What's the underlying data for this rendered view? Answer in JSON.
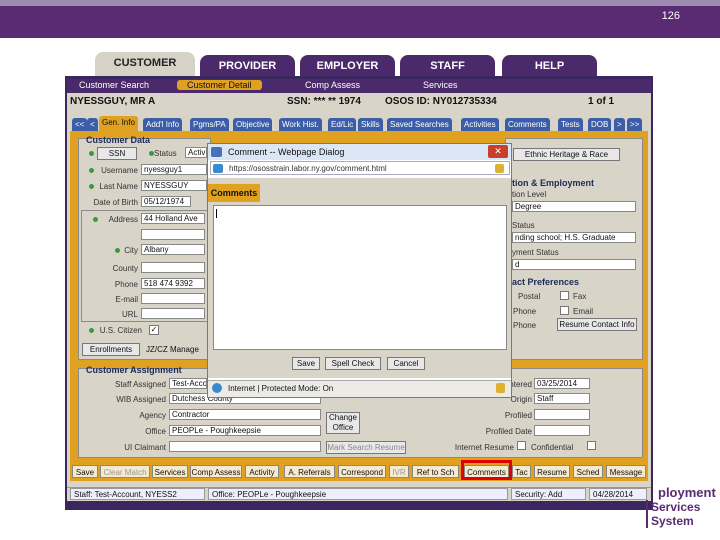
{
  "slide_number": "126",
  "main_tabs": [
    "CUSTOMER",
    "PROVIDER",
    "EMPLOYER",
    "STAFF",
    "HELP"
  ],
  "sub_nav": [
    "Customer Search",
    "Customer Detail",
    "Comp Assess",
    "Services"
  ],
  "header": {
    "name": "NYESSGUY, MR A",
    "ssn": "SSN: *** ** 1974",
    "osos_id": "OSOS ID: NY012735334",
    "page": "1 of 1"
  },
  "sub_tabs": [
    "<<",
    "<",
    "Gen. Info",
    "Add'l Info",
    "Pgms/PA",
    "Objective",
    "Work Hist.",
    "Ed/Lic",
    "Skills",
    "Saved Searches",
    "Activities",
    "Comments",
    "Tests",
    "DOB",
    ">",
    ">>"
  ],
  "customer_data": {
    "title": "Customer Data",
    "ssn_button": "SSN",
    "status_label": "Status",
    "status_value": "Activ",
    "username_label": "Username",
    "username_value": "nyessguy1",
    "last_name_label": "Last Name",
    "last_name_value": "NYESSGUY",
    "dob_label": "Date of Birth",
    "dob_value": "05/12/1974",
    "address_label": "Address",
    "address_value": "44 Holland Ave",
    "city_label": "City",
    "city_value": "Albany",
    "county_label": "County",
    "phone_label": "Phone",
    "phone_value": "518 474 9392",
    "email_label": "E-mail",
    "url_label": "URL",
    "us_citizen_label": "U.S. Citizen",
    "enrollments_button": "Enrollments",
    "manager_text": "JZ/CZ Manage"
  },
  "right_panel": {
    "ethnic_button": "Ethnic Heritage & Race",
    "education_title": "tion & Employment",
    "edu_level_label": "tion Level",
    "edu_level_value": "Degree",
    "status_label": "Status",
    "status_value": "nding school; H.S. Graduate",
    "emp_status_label": "yment Status",
    "emp_status_value": "d",
    "contact_title": "act Preferences",
    "postal": "Postal",
    "fax": "Fax",
    "phone": "Phone",
    "email": "Email",
    "phone2": "Phone",
    "resume_contact_button": "Resume Contact Info"
  },
  "assignment": {
    "title": "Customer Assignment",
    "staff_label": "Staff Assigned",
    "staff_value": "Test-Acco",
    "wib_label": "WIB Assigned",
    "wib_value": "Dutchess County",
    "agency_label": "Agency",
    "agency_value": "Contractor",
    "office_label": "Office",
    "office_value": "PEOPLe - Poughkeepsie",
    "claimant_label": "UI Claimant",
    "change_office_button": "Change Office",
    "mark_resume_button": "Mark Search Resume",
    "entered_label": "Entered",
    "entered_value": "03/25/2014",
    "origin_label": "Origin",
    "origin_value": "Staff",
    "profiled_label": "Profiled",
    "profiled_date_label": "Profiled Date",
    "internet_resume_label": "Internet Resume",
    "confidential_label": "Confidential"
  },
  "actions": [
    "Save",
    "Clear Match",
    "Services",
    "Comp Assess",
    "Activity",
    "A. Referrals",
    "Correspond",
    "IVR",
    "Ref to Sch",
    "Comments",
    "Tac",
    "Resume",
    "Sched",
    "Message"
  ],
  "status_bar": {
    "staff": "Staff: Test-Account, NYESS2",
    "office": "Office: PEOPLe - Poughkeepsie",
    "security": "Security: Add",
    "date": "04/28/2014"
  },
  "dialog": {
    "title": "Comment -- Webpage Dialog",
    "url": "https://ososstrain.labor.ny.gov/comment.html",
    "tab": "Comments",
    "save_button": "Save",
    "spell_check_button": "Spell Check",
    "cancel_button": "Cancel",
    "status": "Internet | Protected Mode: On"
  },
  "logo": {
    "line1": "ployment",
    "line2": "Services System"
  }
}
